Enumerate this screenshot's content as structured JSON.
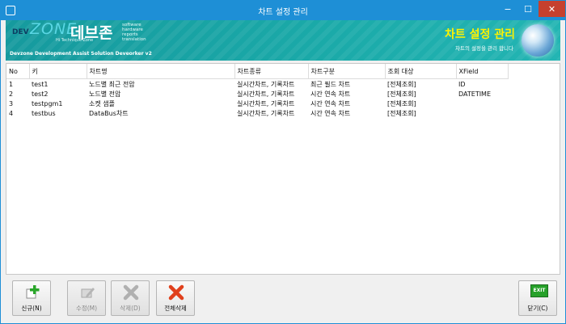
{
  "window": {
    "title": "차트 설정 관리",
    "minimize_glyph": "−",
    "maximize_glyph": "☐",
    "close_glyph": "✕"
  },
  "banner": {
    "logo_dev": "DEV",
    "logo_zone": "ZONE",
    "logo_tagline": "Hi Technique Zone",
    "logo_korean": "데브존",
    "logo_words": [
      "software",
      "hardware",
      "reports",
      "translation"
    ],
    "logo_subtitle": "Devzone Development Assist Solution Deveorker v2",
    "title": "차트 설정 관리",
    "subtitle": "차트의 설정을 관리 합니다"
  },
  "table": {
    "columns": [
      "No",
      "키",
      "차트명",
      "차트종류",
      "차트구분",
      "조회 대상",
      "XField"
    ],
    "rows": [
      [
        "1",
        "test1",
        "노드별 최근 전압",
        "실시간차트, 기록차트",
        "최근 필드 차트",
        "[전체조회]",
        "ID"
      ],
      [
        "2",
        "test2",
        "노드별 전압",
        "실시간차트, 기록차트",
        "시간 연속 차트",
        "[전체조회]",
        "DATETIME"
      ],
      [
        "3",
        "testpgm1",
        "소켓 샘플",
        "실시간차트, 기록차트",
        "시간 연속 차트",
        "[전체조회]",
        ""
      ],
      [
        "4",
        "testbus",
        "DataBus차트",
        "실시간차트, 기록차트",
        "시간 연속 차트",
        "[전체조회]",
        ""
      ]
    ]
  },
  "toolbar": {
    "new_label": "신규(N)",
    "edit_label": "수정(M)",
    "delete_label": "삭제(D)",
    "delete_all_label": "전체삭제",
    "close_label": "닫기(C)",
    "exit_icon_text": "EXIT"
  },
  "colors": {
    "titlebar": "#1e8fd6",
    "banner": "#1aa9a8",
    "banner_title": "#fff200",
    "close_button": "#c6402e",
    "add_icon": "#2aa62a",
    "delete_icon": "#e0401c"
  }
}
